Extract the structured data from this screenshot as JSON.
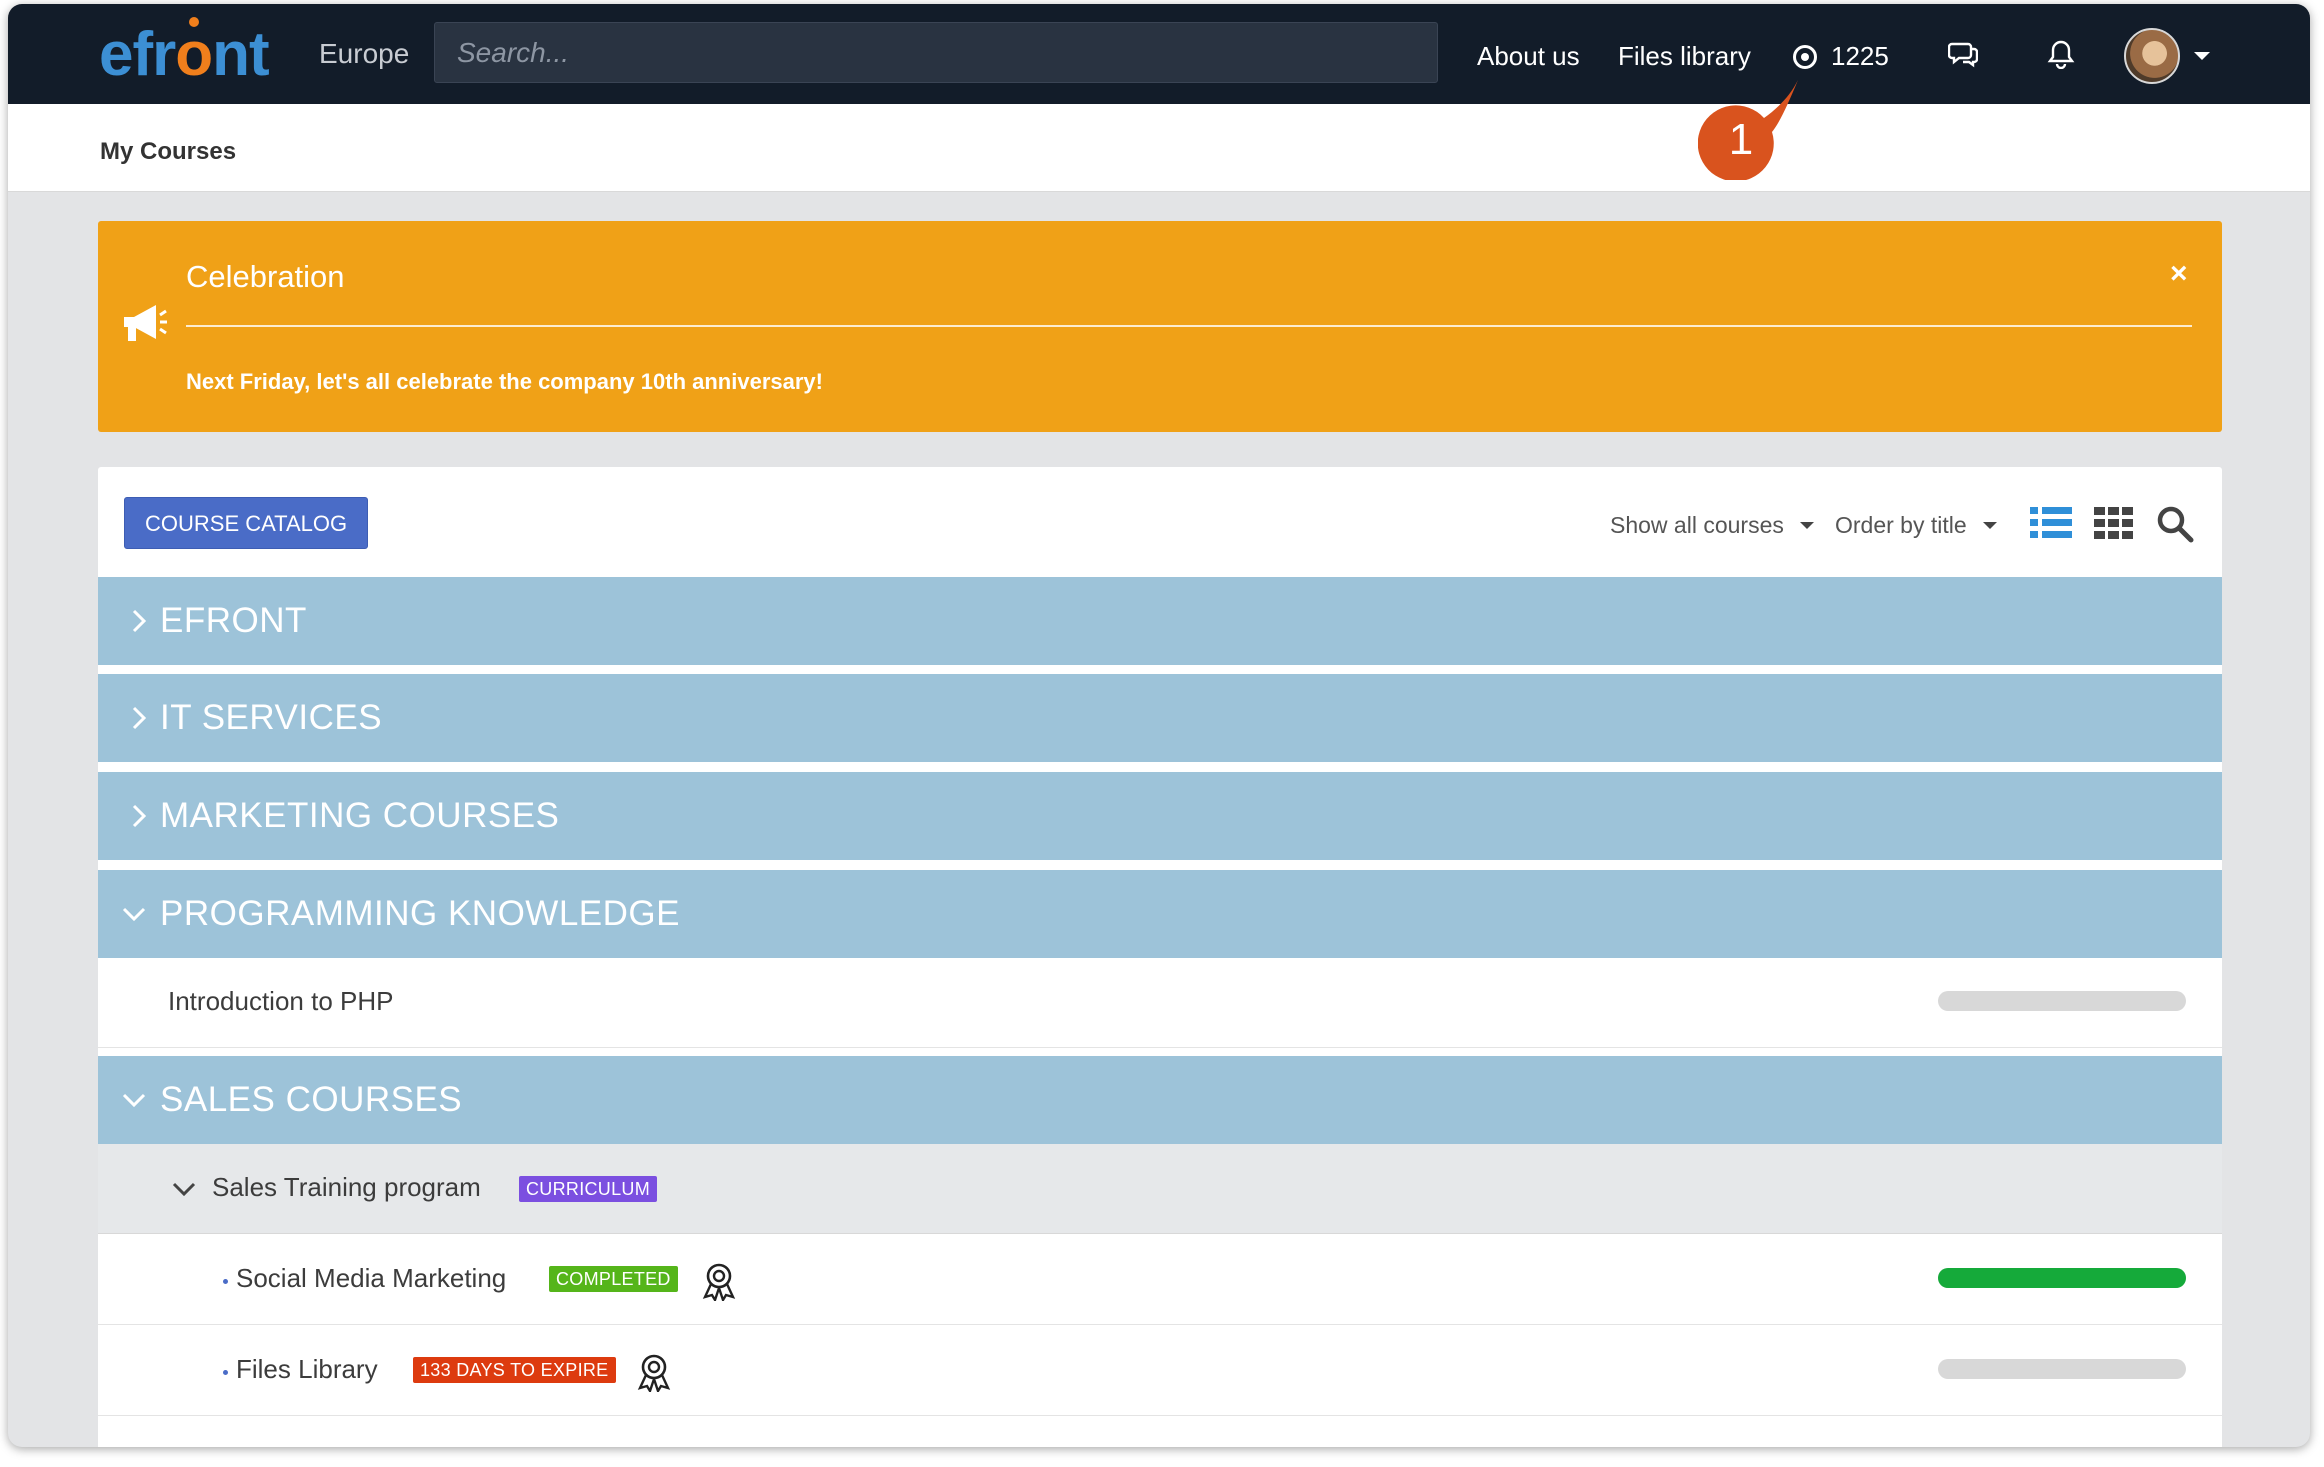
{
  "brand": {
    "logo_text_a": "efr",
    "logo_text_o": "o",
    "logo_text_b": "nt",
    "region": "Europe"
  },
  "search": {
    "placeholder": "Search..."
  },
  "nav": {
    "about": "About us",
    "files": "Files library",
    "points": "1225",
    "icons": [
      "target-icon",
      "chat-icon",
      "bell-icon",
      "avatar",
      "chevron-down-icon"
    ]
  },
  "callout": {
    "number": "1",
    "color": "#d9531e"
  },
  "page": {
    "title": "My Courses"
  },
  "announcement": {
    "title": "Celebration",
    "message": "Next Friday, let's all celebrate the company 10th anniversary!",
    "close": "×",
    "color": "#f0a117"
  },
  "toolbar": {
    "catalog_button": "COURSE CATALOG",
    "filter": "Show all courses",
    "order": "Order by title",
    "views": [
      "list-view-icon",
      "grid-view-icon",
      "search-icon"
    ]
  },
  "categories": [
    {
      "label": "EFRONT",
      "expanded": false
    },
    {
      "label": "IT SERVICES",
      "expanded": false
    },
    {
      "label": "MARKETING COURSES",
      "expanded": false
    },
    {
      "label": "PROGRAMMING KNOWLEDGE",
      "expanded": true
    },
    {
      "label": "SALES COURSES",
      "expanded": true
    }
  ],
  "courses": {
    "programming": [
      {
        "name": "Introduction to PHP",
        "progress": 0
      }
    ],
    "sales_curriculum": {
      "name": "Sales Training program",
      "tag": "CURRICULUM",
      "tag_color": "#7b4fe0",
      "items": [
        {
          "name": "Social Media Marketing",
          "status": "COMPLETED",
          "status_color": "#55b51a",
          "progress": 1.0
        },
        {
          "name": "Files Library",
          "status": "133 DAYS TO EXPIRE",
          "status_color": "#dd3b0f",
          "progress": 0
        }
      ]
    }
  },
  "colors": {
    "topbar": "#121c29",
    "category": "#9dc3d9",
    "accent": "#4a6cc7",
    "progress_fill": "#15aa3a"
  }
}
